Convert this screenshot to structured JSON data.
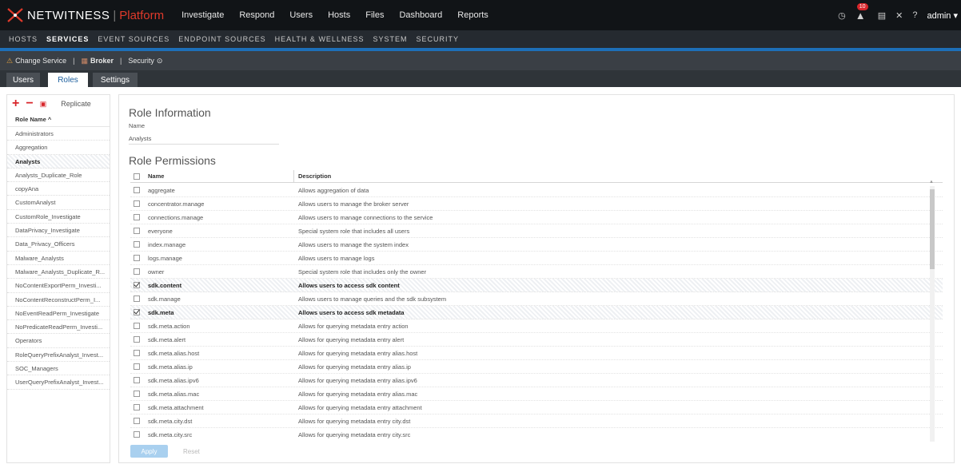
{
  "brand": {
    "name": "NETWITNESS",
    "product": "Platform"
  },
  "main_nav": [
    "Investigate",
    "Respond",
    "Users",
    "Hosts",
    "Files",
    "Dashboard",
    "Reports"
  ],
  "top_right": {
    "notification_count": "10",
    "user": "admin"
  },
  "sub_nav": [
    "HOSTS",
    "SERVICES",
    "EVENT SOURCES",
    "ENDPOINT SOURCES",
    "HEALTH & WELLNESS",
    "SYSTEM",
    "SECURITY"
  ],
  "sub_nav_active": "SERVICES",
  "toolbar": {
    "change_service": "Change Service",
    "service_name": "Broker",
    "context": "Security"
  },
  "tabs": [
    "Users",
    "Roles",
    "Settings"
  ],
  "active_tab": "Roles",
  "role_list": {
    "replicate_label": "Replicate",
    "header": "Role Name ^",
    "roles": [
      "Administrators",
      "Aggregation",
      "Analysts",
      "Analysts_Duplicate_Role",
      "copyAna",
      "CustomAnalyst",
      "CustomRole_Investigate",
      "DataPrivacy_Investigate",
      "Data_Privacy_Officers",
      "Malware_Analysts",
      "Malware_Analysts_Duplicate_R...",
      "NoContentExportPerm_Investi...",
      "NoContentReconstructPerm_I...",
      "NoEventReadPerm_Investigate",
      "NoPredicateReadPerm_Investi...",
      "Operators",
      "RoleQueryPrefixAnalyst_Invest...",
      "SOC_Managers",
      "UserQueryPrefixAnalyst_Invest..."
    ],
    "selected": "Analysts"
  },
  "role_info": {
    "title": "Role Information",
    "name_label": "Name",
    "name_value": "Analysts"
  },
  "permissions": {
    "title": "Role Permissions",
    "col_name": "Name",
    "col_desc": "Description",
    "rows": [
      {
        "name": "aggregate",
        "desc": "Allows aggregation of data",
        "checked": false
      },
      {
        "name": "concentrator.manage",
        "desc": "Allows users to manage the broker server",
        "checked": false
      },
      {
        "name": "connections.manage",
        "desc": "Allows users to manage connections to the service",
        "checked": false
      },
      {
        "name": "everyone",
        "desc": "Special system role that includes all users",
        "checked": false
      },
      {
        "name": "index.manage",
        "desc": "Allows users to manage the system index",
        "checked": false
      },
      {
        "name": "logs.manage",
        "desc": "Allows users to manage logs",
        "checked": false
      },
      {
        "name": "owner",
        "desc": "Special system role that includes only the owner",
        "checked": false
      },
      {
        "name": "sdk.content",
        "desc": "Allows users to access sdk content",
        "checked": true
      },
      {
        "name": "sdk.manage",
        "desc": "Allows users to manage queries and the sdk subsystem",
        "checked": false
      },
      {
        "name": "sdk.meta",
        "desc": "Allows users to access sdk metadata",
        "checked": true
      },
      {
        "name": "sdk.meta.action",
        "desc": "Allows for querying metadata entry action",
        "checked": false
      },
      {
        "name": "sdk.meta.alert",
        "desc": "Allows for querying metadata entry alert",
        "checked": false
      },
      {
        "name": "sdk.meta.alias.host",
        "desc": "Allows for querying metadata entry alias.host",
        "checked": false
      },
      {
        "name": "sdk.meta.alias.ip",
        "desc": "Allows for querying metadata entry alias.ip",
        "checked": false
      },
      {
        "name": "sdk.meta.alias.ipv6",
        "desc": "Allows for querying metadata entry alias.ipv6",
        "checked": false
      },
      {
        "name": "sdk.meta.alias.mac",
        "desc": "Allows for querying metadata entry alias.mac",
        "checked": false
      },
      {
        "name": "sdk.meta.attachment",
        "desc": "Allows for querying metadata entry attachment",
        "checked": false
      },
      {
        "name": "sdk.meta.city.dst",
        "desc": "Allows for querying metadata entry city.dst",
        "checked": false
      },
      {
        "name": "sdk.meta.city.src",
        "desc": "Allows for querying metadata entry city.src",
        "checked": false
      }
    ]
  },
  "buttons": {
    "apply": "Apply",
    "reset": "Reset"
  },
  "colors": {
    "accent": "#1d6fb8",
    "brand_red": "#e03a2b",
    "topbar": "#111417"
  }
}
